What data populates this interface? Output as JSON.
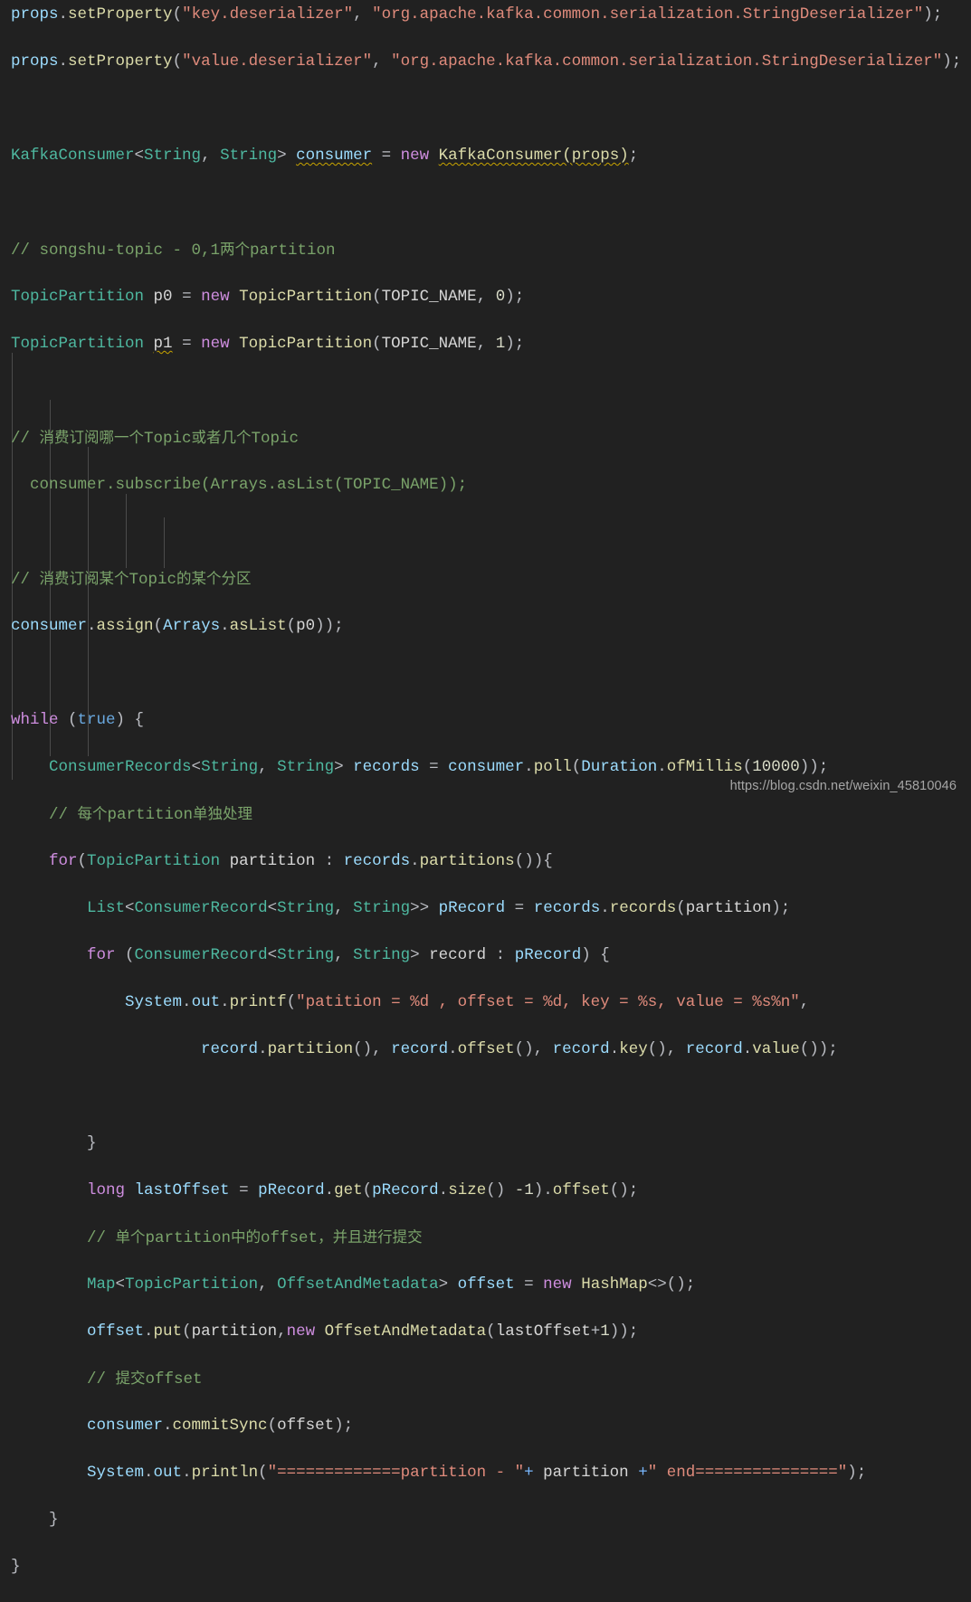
{
  "editor": {
    "background": "#212121",
    "language": "java",
    "font_size_px": 17.5,
    "line_height_px": 26,
    "watermark": "https://blog.csdn.net/weixin_45810046",
    "colors": {
      "background": "#212121",
      "default_text": "#bcbec4",
      "keyword": "#cf8ee0",
      "type": "#4eb8a0",
      "variable": "#9cdcfe",
      "method": "#dcdcaa",
      "string": "#e08b7c",
      "number": "#d9dcc8",
      "comment": "#7aa36a",
      "error_underline": "#c8a400",
      "indent_guide": "#4b4b4b",
      "watermark": "#a6a6a6"
    },
    "indent_guides_x": [
      13,
      55,
      97,
      139,
      181,
      223
    ]
  },
  "code": {
    "lines": [
      "props.setProperty(\"key.deserializer\", \"org.apache.kafka.common.serialization.StringDeserializer\");",
      "props.setProperty(\"value.deserializer\", \"org.apache.kafka.common.serialization.StringDeserializer\");",
      "",
      "KafkaConsumer<String, String> consumer = new KafkaConsumer(props);",
      "",
      "// songshu-topic - 0,1两个partition",
      "TopicPartition p0 = new TopicPartition(TOPIC_NAME, 0);",
      "TopicPartition p1 = new TopicPartition(TOPIC_NAME, 1);",
      "",
      "// 消费订阅哪一个Topic或者几个Topic",
      "  consumer.subscribe(Arrays.asList(TOPIC_NAME));",
      "",
      "// 消费订阅某个Topic的某个分区",
      "consumer.assign(Arrays.asList(p0));",
      "",
      "while (true) {",
      "    ConsumerRecords<String, String> records = consumer.poll(Duration.ofMillis(10000));",
      "    // 每个partition单独处理",
      "    for(TopicPartition partition : records.partitions()){",
      "        List<ConsumerRecord<String, String>> pRecord = records.records(partition);",
      "        for (ConsumerRecord<String, String> record : pRecord) {",
      "            System.out.printf(\"patition = %d , offset = %d, key = %s, value = %s%n\",",
      "                    record.partition(), record.offset(), record.key(), record.value());",
      "",
      "        }",
      "        long lastOffset = pRecord.get(pRecord.size() -1).offset();",
      "        // 单个partition中的offset，并且进行提交",
      "        Map<TopicPartition, OffsetAndMetadata> offset = new HashMap<>();",
      "        offset.put(partition,new OffsetAndMetadata(lastOffset+1));",
      "        // 提交offset",
      "        consumer.commitSync(offset);",
      "        System.out.println(\"=============partition - \"+ partition +\" end===============\");",
      "    }",
      "}"
    ],
    "tokens": {
      "l1": {
        "obj": "props",
        "dot": ".",
        "method": "setProperty",
        "open": "(",
        "s1": "\"key.deserializer\"",
        "comma": ", ",
        "s2": "\"org.apache.kafka.common.serialization.StringDeserializer\"",
        "close": ");"
      },
      "l2": {
        "obj": "props",
        "dot": ".",
        "method": "setProperty",
        "open": "(",
        "s1": "\"value.deserializer\"",
        "comma": ", ",
        "s2": "\"org.apache.kafka.common.serialization.StringDeserializer\"",
        "close": ");"
      },
      "l4": {
        "type": "KafkaConsumer",
        "generics": "<String, String>",
        "generic_a": "String",
        "generic_b": "String",
        "var": "consumer",
        "eq": " = ",
        "kw_new": "new",
        "ctor": "KafkaConsumer",
        "args": "(props);"
      },
      "l6_comment": "// songshu-topic - 0,1两个partition",
      "l7": {
        "type": "TopicPartition",
        "var": "p0",
        "eq": " = ",
        "kw_new": "new",
        "ctor": "TopicPartition",
        "arg1": "TOPIC_NAME",
        "arg2": "0"
      },
      "l8": {
        "type": "TopicPartition",
        "var": "p1",
        "eq": " = ",
        "kw_new": "new",
        "ctor": "TopicPartition",
        "arg1": "TOPIC_NAME",
        "arg2": "1"
      },
      "l10_comment": "// 消费订阅哪一个Topic或者几个Topic",
      "l11_commented_code": "  consumer.subscribe(Arrays.asList(TOPIC_NAME));",
      "l13_comment": "// 消费订阅某个Topic的某个分区",
      "l14": {
        "obj": "consumer",
        "method": "assign",
        "inner_type": "Arrays",
        "inner_method": "asList",
        "arg": "p0"
      },
      "l16": {
        "kw": "while",
        "cond": "true"
      },
      "l17": {
        "type": "ConsumerRecords",
        "var": "records",
        "obj": "consumer",
        "method": "poll",
        "dur_type": "Duration",
        "dur_method": "ofMillis",
        "millis": "10000"
      },
      "l18_comment": "// 每个partition单独处理",
      "l19": {
        "kw": "for",
        "type": "TopicPartition",
        "var": "partition",
        "src": "records",
        "method": "partitions"
      },
      "l20": {
        "type": "List",
        "inner": "ConsumerRecord",
        "var": "pRecord",
        "src": "records",
        "method": "records",
        "arg": "partition"
      },
      "l21": {
        "kw": "for",
        "type": "ConsumerRecord",
        "var": "record",
        "src": "pRecord"
      },
      "l22": {
        "sys": "System",
        "out": "out",
        "method": "printf",
        "format": "\"patition = %d , offset = %d, key = %s, value = %s%n\""
      },
      "l23": {
        "a": "record.partition()",
        "b": "record.offset()",
        "c": "record.key()",
        "d": "record.value()"
      },
      "l26": {
        "kw": "long",
        "var": "lastOffset",
        "src": "pRecord",
        "get": "get",
        "size": "size",
        "minus": "-1",
        "offset": "offset"
      },
      "l27_comment": "// 单个partition中的offset，并且进行提交",
      "l28": {
        "type": "Map",
        "k": "TopicPartition",
        "v": "OffsetAndMetadata",
        "var": "offset",
        "kw_new": "new",
        "ctor": "HashMap<>()"
      },
      "l29": {
        "obj": "offset",
        "method": "put",
        "arg1": "partition",
        "kw_new": "new",
        "ctor": "OffsetAndMetadata",
        "expr": "lastOffset+1"
      },
      "l30_comment": "// 提交offset",
      "l31": {
        "obj": "consumer",
        "method": "commitSync",
        "arg": "offset"
      },
      "l32": {
        "sys": "System",
        "out": "out",
        "method": "println",
        "s1": "\"=============partition - \"",
        "plus1": "+",
        "mid": " partition ",
        "plus2": "+",
        "s2": "\" end===============\""
      }
    }
  }
}
